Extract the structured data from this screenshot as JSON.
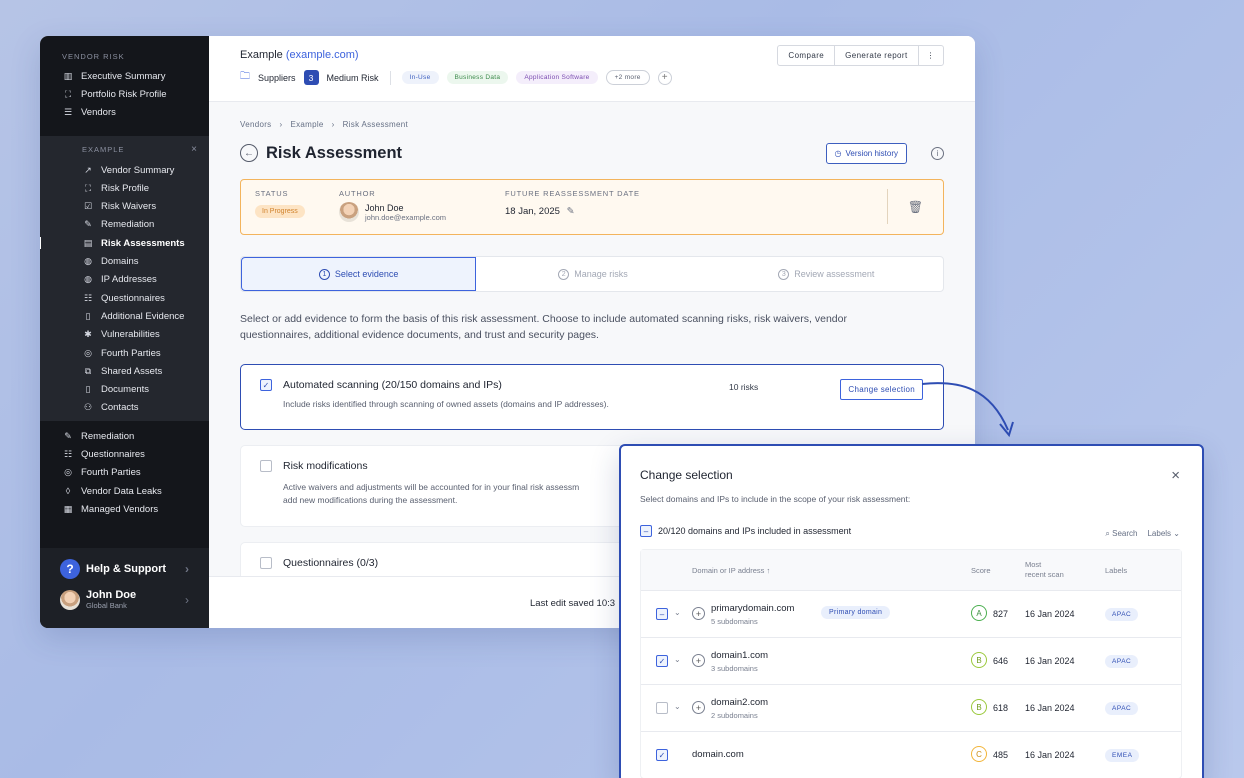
{
  "sidebar": {
    "section_label": "VENDOR RISK",
    "top_items": [
      {
        "label": "Executive Summary",
        "icon": "bar-chart-icon"
      },
      {
        "label": "Portfolio Risk Profile",
        "icon": "scan-icon"
      },
      {
        "label": "Vendors",
        "icon": "list-icon"
      }
    ],
    "group": {
      "label": "EXAMPLE",
      "close": "×",
      "items": [
        {
          "label": "Vendor Summary",
          "icon": "trend-icon"
        },
        {
          "label": "Risk Profile",
          "icon": "scan-icon"
        },
        {
          "label": "Risk Waivers",
          "icon": "checkbox-icon"
        },
        {
          "label": "Remediation",
          "icon": "wrench-icon"
        },
        {
          "label": "Risk Assessments",
          "icon": "document-icon"
        },
        {
          "label": "Domains",
          "icon": "globe-icon"
        },
        {
          "label": "IP Addresses",
          "icon": "globe-icon"
        },
        {
          "label": "Questionnaires",
          "icon": "checklist-icon"
        },
        {
          "label": "Additional Evidence",
          "icon": "file-icon"
        },
        {
          "label": "Vulnerabilities",
          "icon": "bug-icon"
        },
        {
          "label": "Fourth Parties",
          "icon": "network-icon"
        },
        {
          "label": "Shared Assets",
          "icon": "share-icon"
        },
        {
          "label": "Documents",
          "icon": "file-icon"
        },
        {
          "label": "Contacts",
          "icon": "contacts-icon"
        }
      ]
    },
    "bottom_items": [
      {
        "label": "Remediation",
        "icon": "wrench-icon"
      },
      {
        "label": "Questionnaires",
        "icon": "checklist-icon"
      },
      {
        "label": "Fourth Parties",
        "icon": "network-icon"
      },
      {
        "label": "Vendor Data Leaks",
        "icon": "drop-icon"
      },
      {
        "label": "Managed Vendors",
        "icon": "building-icon"
      }
    ],
    "help": "Help & Support",
    "user": {
      "name": "John Doe",
      "org": "Global Bank"
    }
  },
  "header": {
    "vendor": "Example",
    "domain": "(example.com)",
    "category": "Suppliers",
    "risk_level": "3",
    "risk_label": "Medium Risk",
    "tags": [
      "In-Use",
      "Business Data",
      "Application Software"
    ],
    "more_tags": "+2 more",
    "buttons": {
      "compare": "Compare",
      "report": "Generate report",
      "more": "⋮"
    }
  },
  "breadcrumb": [
    "Vendors",
    "Example",
    "Risk Assessment"
  ],
  "page": {
    "title": "Risk Assessment",
    "version_history": "Version history"
  },
  "status_card": {
    "status_label": "STATUS",
    "status_value": "In Progress",
    "author_label": "AUTHOR",
    "author_name": "John Doe",
    "author_email": "john.doe@example.com",
    "date_label": "FUTURE REASSESSMENT DATE",
    "date_value": "18 Jan, 2025"
  },
  "steps": [
    {
      "num": "1",
      "label": "Select evidence"
    },
    {
      "num": "2",
      "label": "Manage risks"
    },
    {
      "num": "3",
      "label": "Review assessment"
    }
  ],
  "intro": "Select or add evidence to form the basis of this risk assessment. Choose to include automated scanning risks, risk waivers, vendor questionnaires, additional evidence documents, and trust and security pages.",
  "cards": {
    "scanning": {
      "title": "Automated scanning (20/150 domains and IPs)",
      "desc": "Include risks identified through scanning of owned assets (domains and IP addresses).",
      "risks": "10 risks",
      "button": "Change selection"
    },
    "modifications": {
      "title": "Risk modifications",
      "desc1": "Active waivers and adjustments will be accounted for in your final risk assessm",
      "desc2": "add new modifications during the assessment."
    },
    "questionnaires": {
      "title": "Questionnaires (0/3)"
    }
  },
  "savebar": {
    "text": "Last edit saved 10:3"
  },
  "modal": {
    "title": "Change selection",
    "close": "×",
    "subtitle": "Select domains and IPs to include in the scope of your risk assessment:",
    "count": "20/120 domains and IPs included in assessment",
    "search": "Search",
    "labels": "Labels",
    "columns": {
      "domain": "Domain or IP address ↑",
      "score": "Score",
      "scan1": "Most",
      "scan2": "recent scan",
      "labels": "Labels"
    },
    "rows": [
      {
        "domain": "primarydomain.com",
        "subs": "5 subdomains",
        "tag": "Primary domain",
        "grade": "A",
        "score": "827",
        "scan": "16 Jan 2024",
        "label": "APAC"
      },
      {
        "domain": "domain1.com",
        "subs": "3 subdomains",
        "grade": "B",
        "score": "646",
        "scan": "16 Jan 2024",
        "label": "APAC"
      },
      {
        "domain": "domain2.com",
        "subs": "2 subdomains",
        "grade": "B",
        "score": "618",
        "scan": "16 Jan 2024",
        "label": "APAC"
      },
      {
        "domain": "domain.com",
        "grade": "C",
        "score": "485",
        "scan": "16 Jan 2024",
        "label": "EMEA"
      }
    ]
  }
}
